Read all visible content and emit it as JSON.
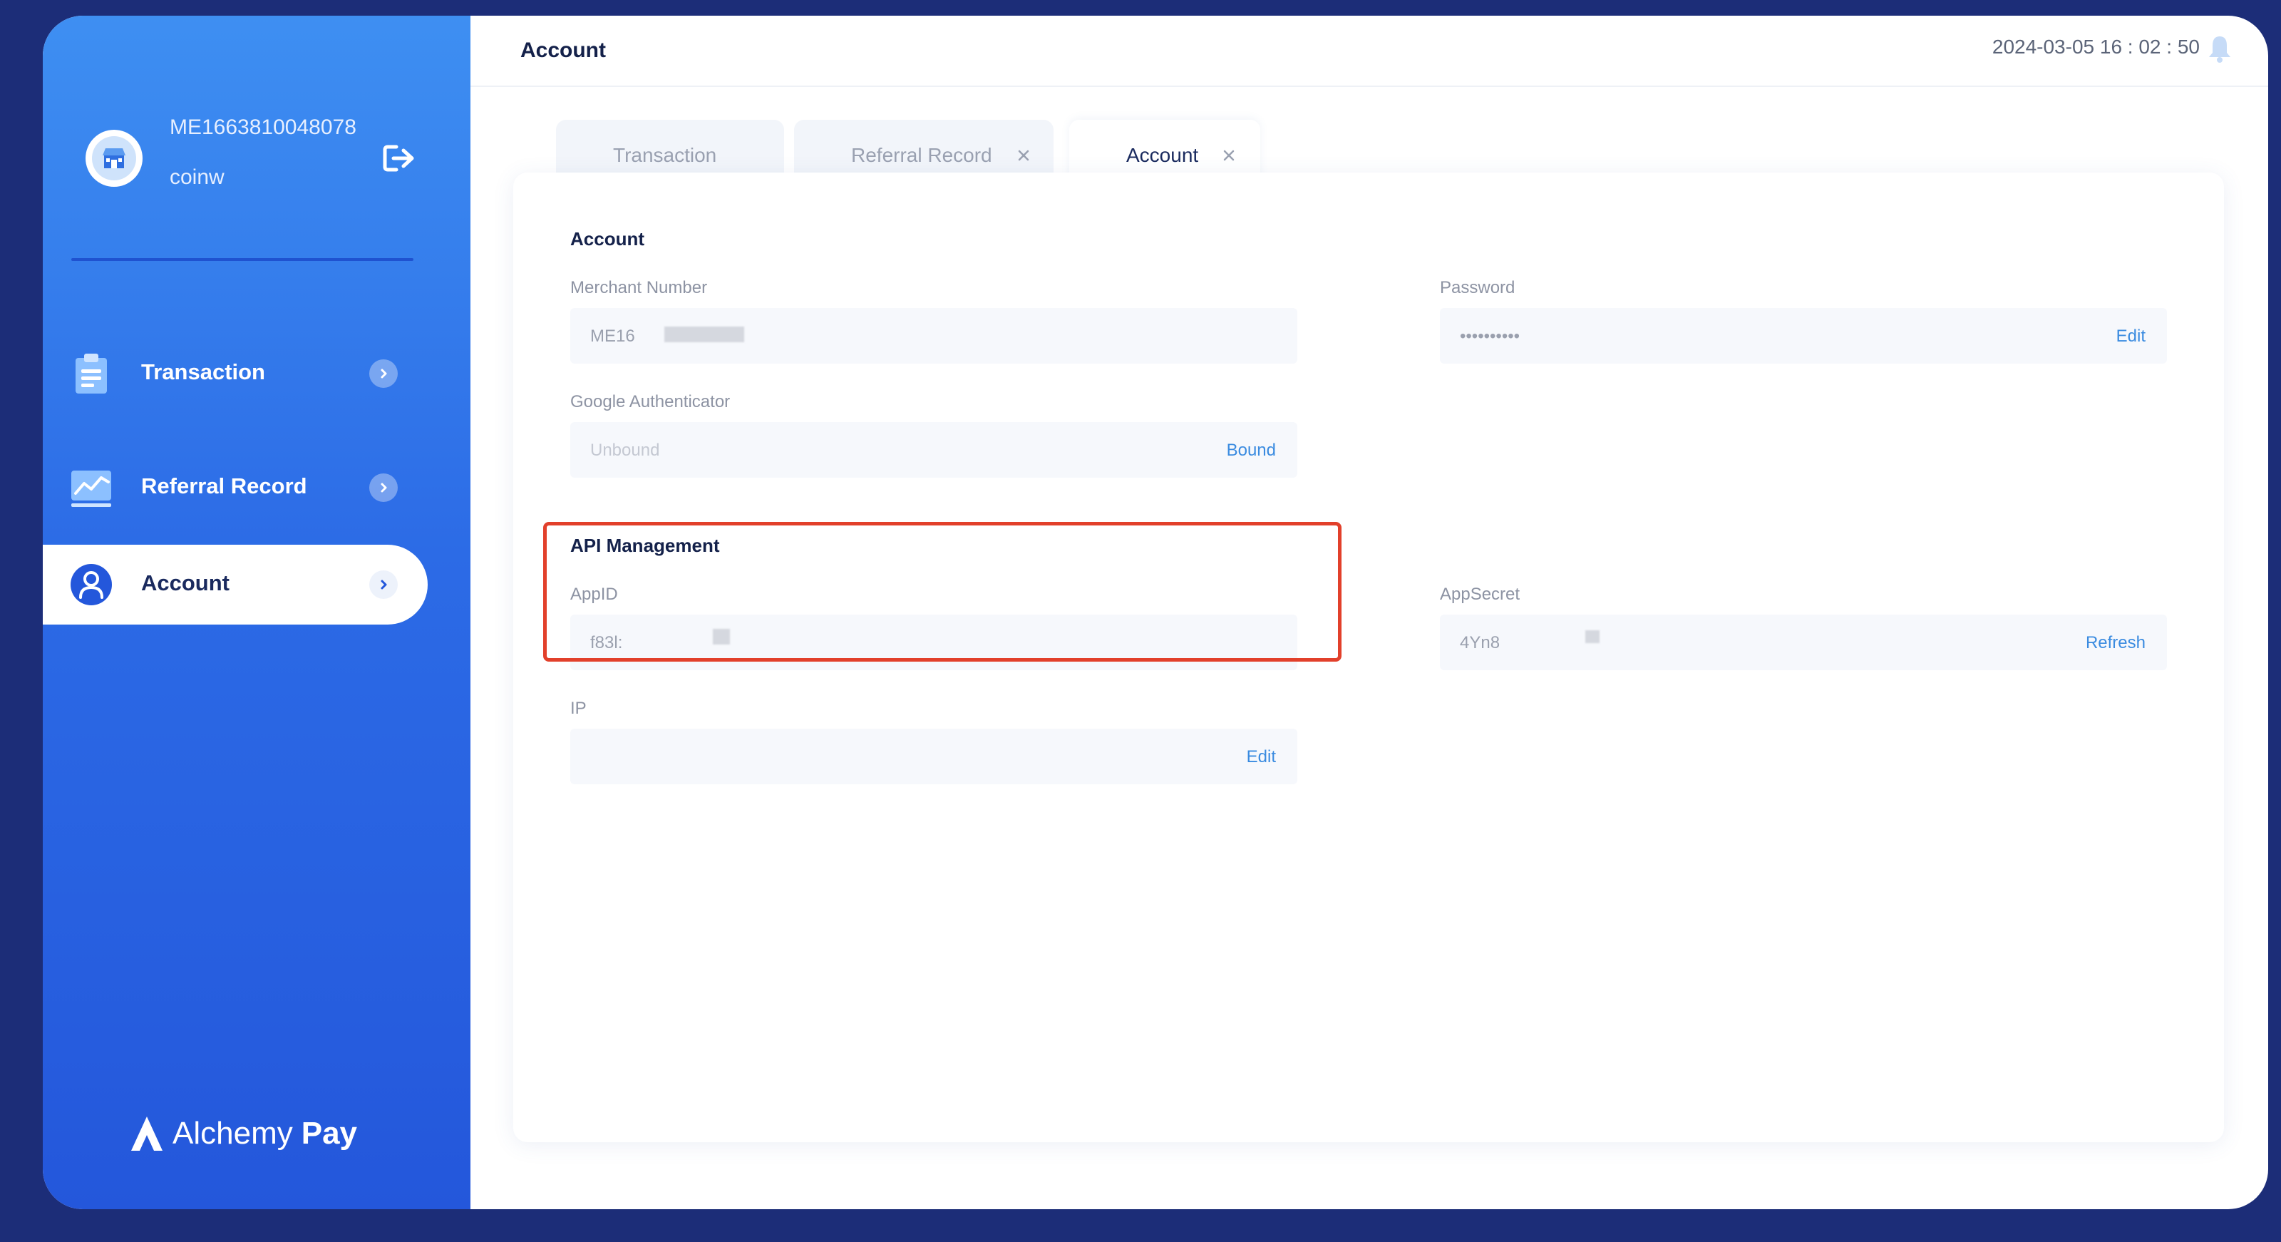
{
  "sidebar": {
    "user_id": "ME1663810048078",
    "user_name": "coinw",
    "nav": [
      {
        "label": "Transaction"
      },
      {
        "label": "Referral Record"
      },
      {
        "label": "Account"
      }
    ],
    "brand": {
      "word1": "Alchemy",
      "word2": "Pay"
    }
  },
  "header": {
    "title": "Account",
    "datetime": "2024-03-05 16 : 02 : 50"
  },
  "tabs": [
    {
      "label": "Transaction",
      "active": false,
      "closable": false
    },
    {
      "label": "Referral Record",
      "active": false,
      "closable": true
    },
    {
      "label": "Account",
      "active": true,
      "closable": true
    }
  ],
  "account": {
    "section_title": "Account",
    "merchant_number": {
      "label": "Merchant Number",
      "value": "ME16"
    },
    "password": {
      "label": "Password",
      "value": "••••••••••",
      "action": "Edit"
    },
    "google_auth": {
      "label": "Google Authenticator",
      "value": "Unbound",
      "action": "Bound"
    }
  },
  "api": {
    "section_title": "API Management",
    "appid": {
      "label": "AppID",
      "value": "f83l:"
    },
    "appsecret": {
      "label": "AppSecret",
      "value": "4Yn8",
      "action": "Refresh"
    },
    "ip": {
      "label": "IP",
      "value": "",
      "action": "Edit"
    }
  },
  "colors": {
    "accent": "#3a8be0",
    "sidebar_top": "#3e8ff2",
    "sidebar_bottom": "#2457db",
    "highlight": "#e2402b",
    "title": "#14214a"
  }
}
